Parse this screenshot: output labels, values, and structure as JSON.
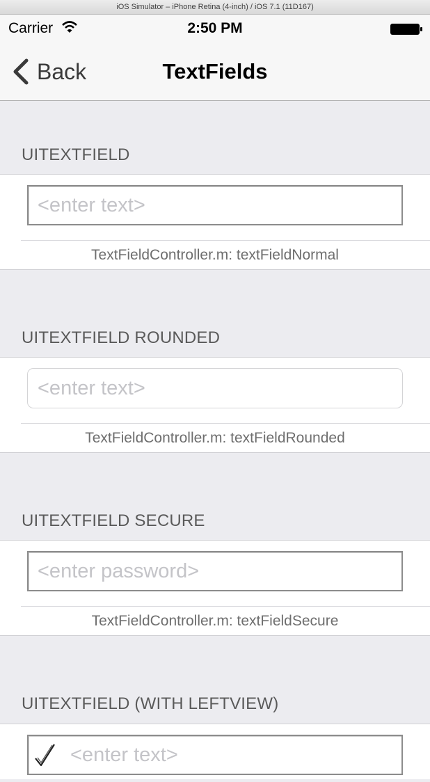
{
  "simulator_title": "iOS Simulator – iPhone Retina (4-inch) / iOS 7.1 (11D167)",
  "status_bar": {
    "carrier": "Carrier",
    "time": "2:50 PM"
  },
  "nav": {
    "back_label": "Back",
    "title": "TextFields"
  },
  "sections": [
    {
      "header": "UITEXTFIELD",
      "placeholder": "<enter text>",
      "caption": "TextFieldController.m: textFieldNormal"
    },
    {
      "header": "UITEXTFIELD ROUNDED",
      "placeholder": "<enter text>",
      "caption": "TextFieldController.m: textFieldRounded"
    },
    {
      "header": "UITEXTFIELD SECURE",
      "placeholder": "<enter password>",
      "caption": "TextFieldController.m: textFieldSecure"
    },
    {
      "header": "UITEXTFIELD (WITH LEFTVIEW)",
      "placeholder": "<enter text>"
    }
  ],
  "icons": {
    "back": "chevron-left-icon",
    "wifi": "wifi-icon",
    "battery": "battery-icon",
    "leftview": "checkmark-icon"
  },
  "colors": {
    "placeholder": "#c4c4c8",
    "grouped_background": "#ececf0",
    "bar_background": "#f7f7f7"
  }
}
